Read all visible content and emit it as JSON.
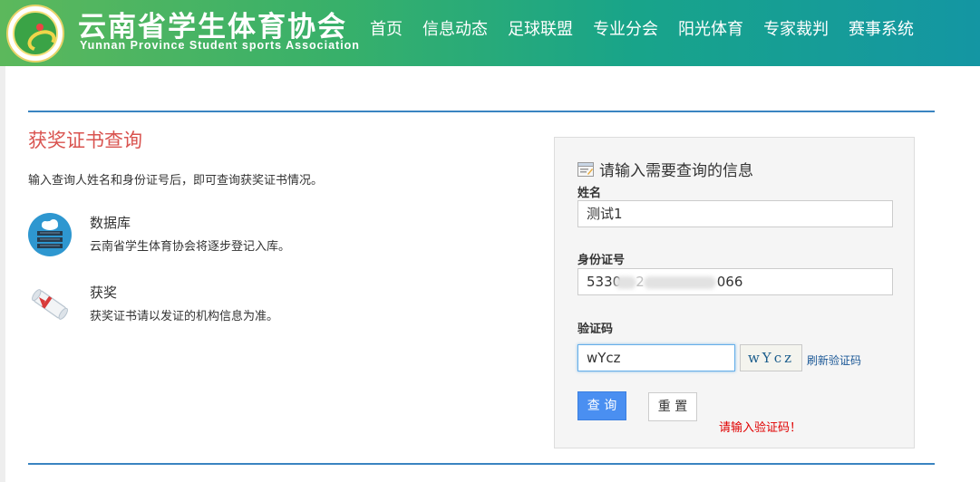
{
  "header": {
    "title_cn": "云南省学生体育协会",
    "title_en": "Yunnan Province Student sports Association",
    "nav": [
      "首页",
      "信息动态",
      "足球联盟",
      "专业分会",
      "阳光体育",
      "专家裁判",
      "赛事系统"
    ]
  },
  "main": {
    "title": "获奖证书查询",
    "intro": "输入查询人姓名和身份证号后，即可查询获奖证书情况。",
    "features": [
      {
        "title": "数据库",
        "desc": "云南省学生体育协会将逐步登记入库。",
        "icon": "database-cloud-icon"
      },
      {
        "title": "获奖",
        "desc": "获奖证书请以发证的机构信息为准。",
        "icon": "certificate-scroll-icon"
      }
    ]
  },
  "form": {
    "heading": "请输入需要查询的信息",
    "name_label": "姓名",
    "name_value": "测试1",
    "id_label": "身份证号",
    "id_prefix": "5330",
    "id_middle_char": "2",
    "id_suffix": "066",
    "captcha_label": "验证码",
    "captcha_value": "wYcz",
    "captcha_image_text": "wYcz",
    "refresh_label": "刷新验证码",
    "query_button": "查 询",
    "reset_button": "重 置",
    "error_message": "请输入验证码！"
  },
  "colors": {
    "accent_rule": "#3a84c1",
    "title_red": "#d9534f",
    "primary_button": "#4a8ff1",
    "error": "#e00000"
  }
}
